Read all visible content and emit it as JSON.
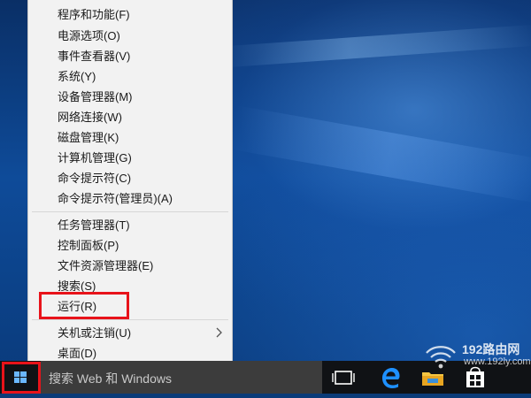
{
  "menu": {
    "items": [
      {
        "label": "程序和功能(F)"
      },
      {
        "label": "电源选项(O)"
      },
      {
        "label": "事件查看器(V)"
      },
      {
        "label": "系统(Y)"
      },
      {
        "label": "设备管理器(M)"
      },
      {
        "label": "网络连接(W)"
      },
      {
        "label": "磁盘管理(K)"
      },
      {
        "label": "计算机管理(G)"
      },
      {
        "label": "命令提示符(C)"
      },
      {
        "label": "命令提示符(管理员)(A)"
      },
      {
        "label": "任务管理器(T)"
      },
      {
        "label": "控制面板(P)"
      },
      {
        "label": "文件资源管理器(E)"
      },
      {
        "label": "搜索(S)"
      },
      {
        "label": "运行(R)"
      },
      {
        "label": "关机或注销(U)"
      },
      {
        "label": "桌面(D)"
      }
    ]
  },
  "taskbar": {
    "search_placeholder": "搜索 Web 和 Windows",
    "icons": [
      "task-view-icon",
      "edge-icon",
      "file-explorer-icon",
      "store-icon"
    ]
  },
  "watermark": {
    "line1": "192路由网",
    "line2": "www.192ly.com"
  },
  "colors": {
    "highlight": "#e8131a",
    "menu_bg": "#f2f2f2",
    "taskbar_bg": "#101215",
    "search_bg": "#3c3c3c",
    "edge_blue": "#1e90ff"
  }
}
